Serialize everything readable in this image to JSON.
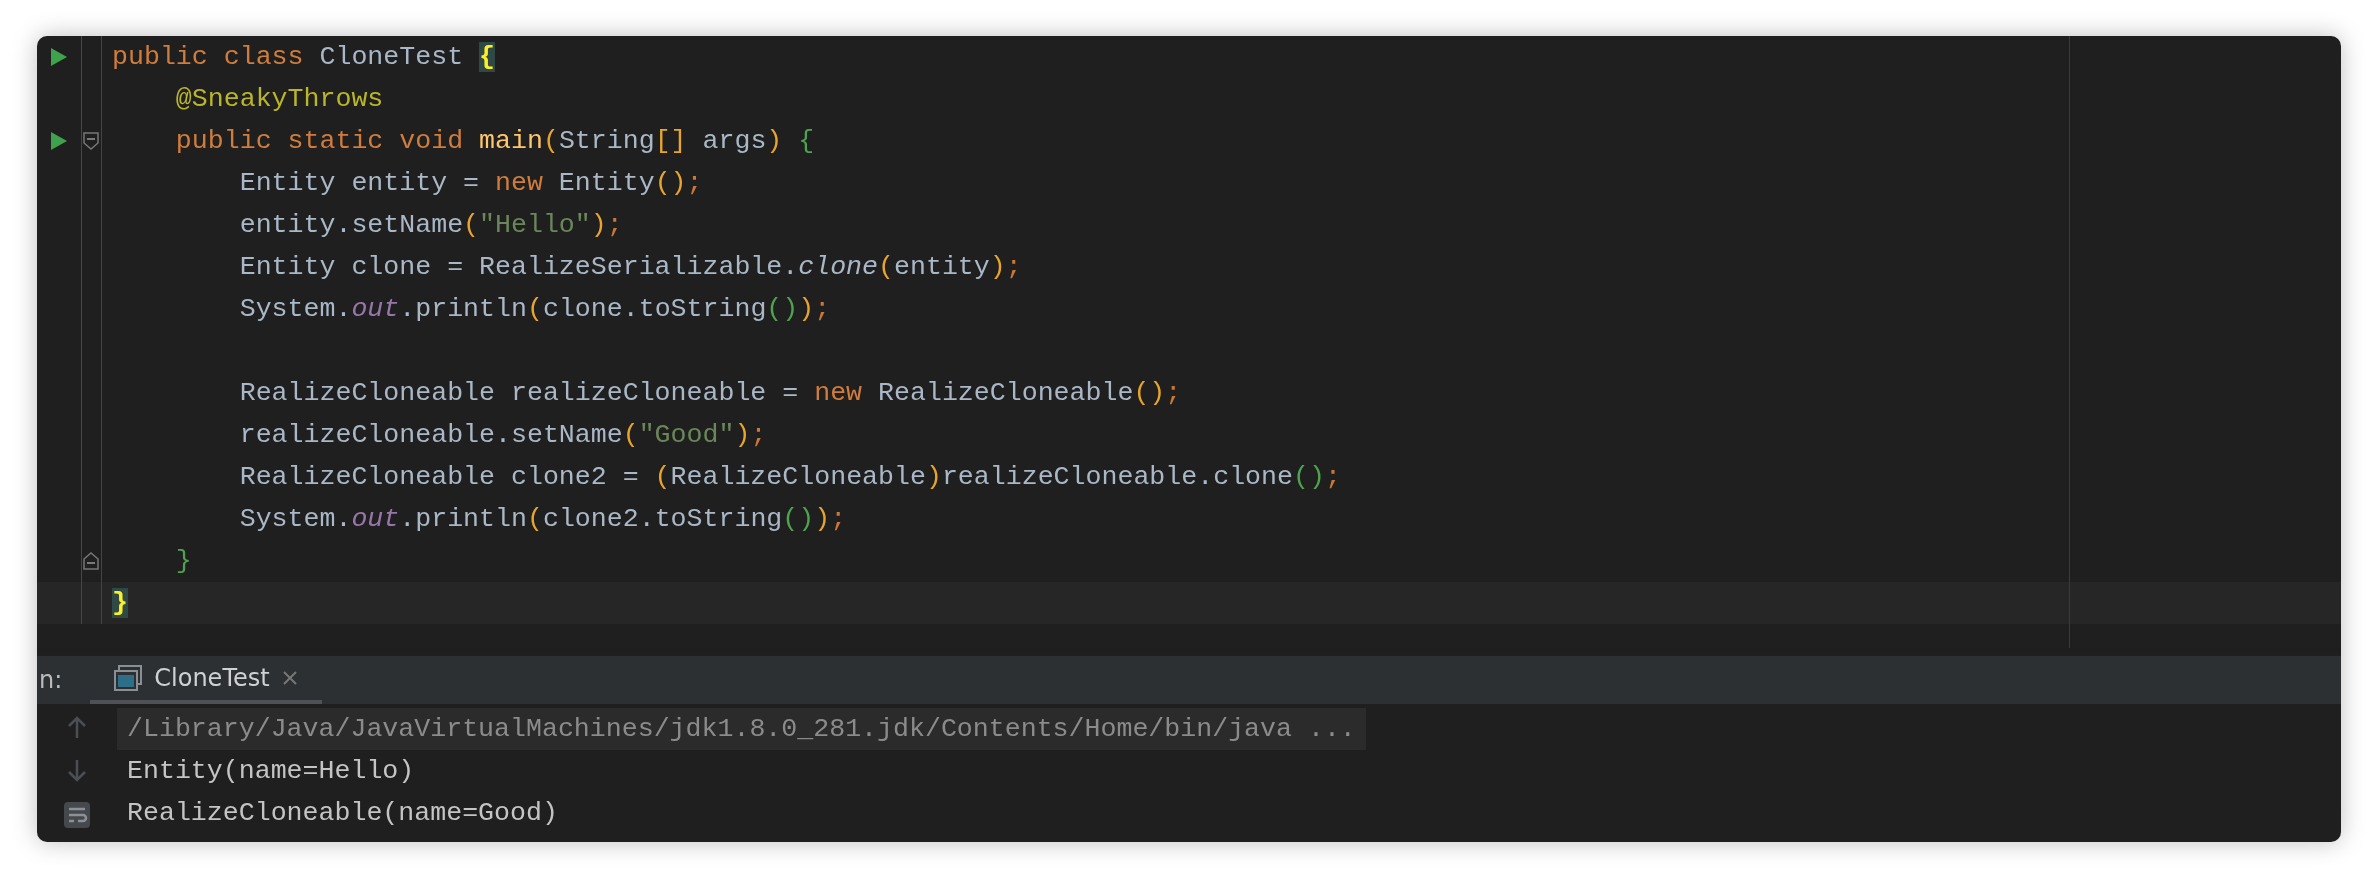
{
  "editor": {
    "lines": [
      {
        "run": true,
        "tokens": [
          {
            "text": "public class ",
            "kind": "keyword"
          },
          {
            "text": "CloneTest ",
            "kind": "plain"
          },
          {
            "text": "{",
            "kind": "brace-match"
          }
        ]
      },
      {
        "run": false,
        "tokens": [
          {
            "text": "    @SneakyThrows",
            "kind": "annotation"
          }
        ]
      },
      {
        "run": true,
        "fold_start": true,
        "tokens": [
          {
            "text": "    public static void ",
            "kind": "keyword"
          },
          {
            "text": "main",
            "kind": "method-decl"
          },
          {
            "text": "(",
            "kind": "paren1"
          },
          {
            "text": "String",
            "kind": "plain"
          },
          {
            "text": "[]",
            "kind": "paren1"
          },
          {
            "text": " args",
            "kind": "plain"
          },
          {
            "text": ") ",
            "kind": "paren1"
          },
          {
            "text": "{",
            "kind": "paren2"
          }
        ]
      },
      {
        "run": false,
        "tokens": [
          {
            "text": "        Entity entity = ",
            "kind": "plain"
          },
          {
            "text": "new ",
            "kind": "keyword"
          },
          {
            "text": "Entity",
            "kind": "plain"
          },
          {
            "text": "()",
            "kind": "paren1"
          },
          {
            "text": ";",
            "kind": "punct"
          }
        ]
      },
      {
        "run": false,
        "tokens": [
          {
            "text": "        entity.setName",
            "kind": "plain"
          },
          {
            "text": "(",
            "kind": "paren1"
          },
          {
            "text": "\"Hello\"",
            "kind": "string"
          },
          {
            "text": ")",
            "kind": "paren1"
          },
          {
            "text": ";",
            "kind": "punct"
          }
        ]
      },
      {
        "run": false,
        "tokens": [
          {
            "text": "        Entity clone = RealizeSerializable.",
            "kind": "plain"
          },
          {
            "text": "clone",
            "kind": "static-method"
          },
          {
            "text": "(",
            "kind": "paren1"
          },
          {
            "text": "entity",
            "kind": "plain"
          },
          {
            "text": ")",
            "kind": "paren1"
          },
          {
            "text": ";",
            "kind": "punct"
          }
        ]
      },
      {
        "run": false,
        "tokens": [
          {
            "text": "        System.",
            "kind": "plain"
          },
          {
            "text": "out",
            "kind": "static-field"
          },
          {
            "text": ".println",
            "kind": "plain"
          },
          {
            "text": "(",
            "kind": "paren1"
          },
          {
            "text": "clone.toString",
            "kind": "plain"
          },
          {
            "text": "()",
            "kind": "paren2"
          },
          {
            "text": ")",
            "kind": "paren1"
          },
          {
            "text": ";",
            "kind": "punct"
          }
        ]
      },
      {
        "run": false
      },
      {
        "run": false,
        "tokens": [
          {
            "text": "        RealizeCloneable realizeCloneable = ",
            "kind": "plain"
          },
          {
            "text": "new ",
            "kind": "keyword"
          },
          {
            "text": "RealizeCloneable",
            "kind": "plain"
          },
          {
            "text": "()",
            "kind": "paren1"
          },
          {
            "text": ";",
            "kind": "punct"
          }
        ]
      },
      {
        "run": false,
        "tokens": [
          {
            "text": "        realizeCloneable.setName",
            "kind": "plain"
          },
          {
            "text": "(",
            "kind": "paren1"
          },
          {
            "text": "\"Good\"",
            "kind": "string"
          },
          {
            "text": ")",
            "kind": "paren1"
          },
          {
            "text": ";",
            "kind": "punct"
          }
        ]
      },
      {
        "run": false,
        "tokens": [
          {
            "text": "        RealizeCloneable clone2 = ",
            "kind": "plain"
          },
          {
            "text": "(",
            "kind": "paren1"
          },
          {
            "text": "RealizeCloneable",
            "kind": "plain"
          },
          {
            "text": ")",
            "kind": "paren1"
          },
          {
            "text": "realizeCloneable.clone",
            "kind": "plain"
          },
          {
            "text": "()",
            "kind": "paren2"
          },
          {
            "text": ";",
            "kind": "punct"
          }
        ]
      },
      {
        "run": false,
        "tokens": [
          {
            "text": "        System.",
            "kind": "plain"
          },
          {
            "text": "out",
            "kind": "static-field"
          },
          {
            "text": ".println",
            "kind": "plain"
          },
          {
            "text": "(",
            "kind": "paren1"
          },
          {
            "text": "clone2.toString",
            "kind": "plain"
          },
          {
            "text": "()",
            "kind": "paren2"
          },
          {
            "text": ")",
            "kind": "paren1"
          },
          {
            "text": ";",
            "kind": "punct"
          }
        ]
      },
      {
        "run": false,
        "fold_end": true,
        "tokens": [
          {
            "text": "    }",
            "kind": "paren2"
          }
        ]
      },
      {
        "run": false,
        "current": true,
        "tokens": [
          {
            "text": "}",
            "kind": "brace-match"
          }
        ]
      }
    ]
  },
  "run_panel": {
    "label": "n:",
    "tabs": [
      {
        "label": "CloneTest",
        "selected": true
      }
    ],
    "toolbar": [
      {
        "kind": "up",
        "disabled": true
      },
      {
        "kind": "down",
        "disabled": true
      },
      {
        "kind": "wrap",
        "disabled": false
      }
    ],
    "output": [
      {
        "text": "/Library/Java/JavaVirtualMachines/jdk1.8.0_281.jdk/Contents/Home/bin/java ...",
        "kind": "command"
      },
      {
        "text": "Entity(name=Hello)",
        "kind": "stdout"
      },
      {
        "text": "RealizeCloneable(name=Good)",
        "kind": "stdout"
      }
    ]
  }
}
